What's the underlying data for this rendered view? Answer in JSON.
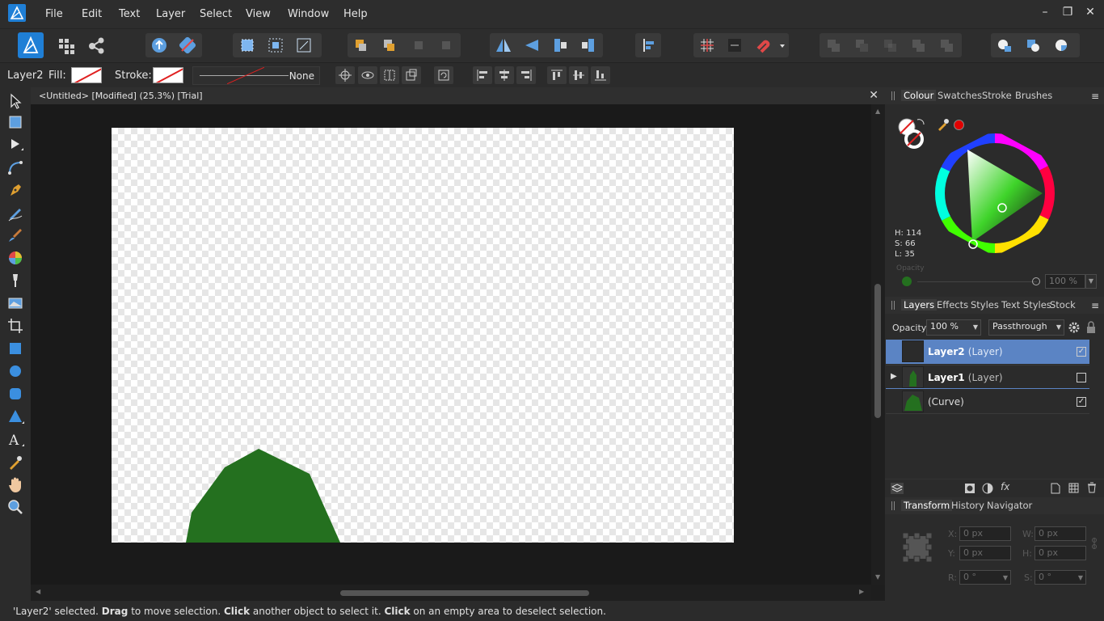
{
  "menu": {
    "items": [
      "File",
      "Edit",
      "Text",
      "Layer",
      "Select",
      "View",
      "Window",
      "Help"
    ]
  },
  "context": {
    "layer_name": "Layer2",
    "fill_label": "Fill:",
    "stroke_label": "Stroke:",
    "stroke_width_value": "None"
  },
  "document": {
    "title": "<Untitled> [Modified] (25.3%) [Trial]"
  },
  "colour_panel": {
    "tabs": [
      "Colour",
      "Swatches",
      "Stroke",
      "Brushes"
    ],
    "h": "H: 114",
    "s": "S: 66",
    "l": "L: 35",
    "opacity_label": "Opacity",
    "opacity_value": "100 %",
    "current_color": "#24701f"
  },
  "layers_panel": {
    "tabs": [
      "Layers",
      "Effects",
      "Styles",
      "Text Styles",
      "Stock"
    ],
    "opacity_label": "Opacity:",
    "opacity_value": "100 %",
    "blend_mode": "Passthrough",
    "rows": [
      {
        "name": "Layer2",
        "type": "(Layer)",
        "checked": "☑"
      },
      {
        "name": "Layer1",
        "type": "(Layer)",
        "checked": ""
      },
      {
        "name": "",
        "type": "(Curve)",
        "checked": "☑"
      }
    ]
  },
  "transform_panel": {
    "tabs": [
      "Transform",
      "History",
      "Navigator"
    ],
    "x_label": "X:",
    "x_value": "0 px",
    "y_label": "Y:",
    "y_value": "0 px",
    "w_label": "W:",
    "w_value": "0 px",
    "h_label": "H:",
    "h_value": "0 px",
    "r_label": "R:",
    "r_value": "0 °",
    "s_label": "S:",
    "s_value": "0 °"
  },
  "status": {
    "part1": "'Layer2' selected. ",
    "b1": "Drag",
    "part2": " to move selection. ",
    "b2": "Click",
    "part3": " another object to select it. ",
    "b3": "Click",
    "part4": " on an empty area to deselect selection."
  },
  "colors": {
    "accent": "#5b84c4",
    "shape_green": "#24701f"
  }
}
